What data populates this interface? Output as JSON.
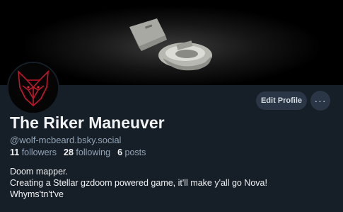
{
  "profile": {
    "display_name": "The Riker Maneuver",
    "handle": "@wolf-mcbeard.bsky.social",
    "stats": {
      "followers_count": "11",
      "followers_label": "followers",
      "following_count": "28",
      "following_label": "following",
      "posts_count": "6",
      "posts_label": "posts"
    },
    "bio": [
      "Doom mapper.",
      "Creating a Stellar gzdoom powered game, it'll make y'all go Nova!",
      "Whyms'tn't've"
    ]
  },
  "actions": {
    "edit_label": "Edit Profile",
    "more_label": "···"
  },
  "colors": {
    "background": "#161e27",
    "button_bg": "#2a3645",
    "muted_text": "#93a5b7",
    "avatar_accent": "#c0182a"
  }
}
